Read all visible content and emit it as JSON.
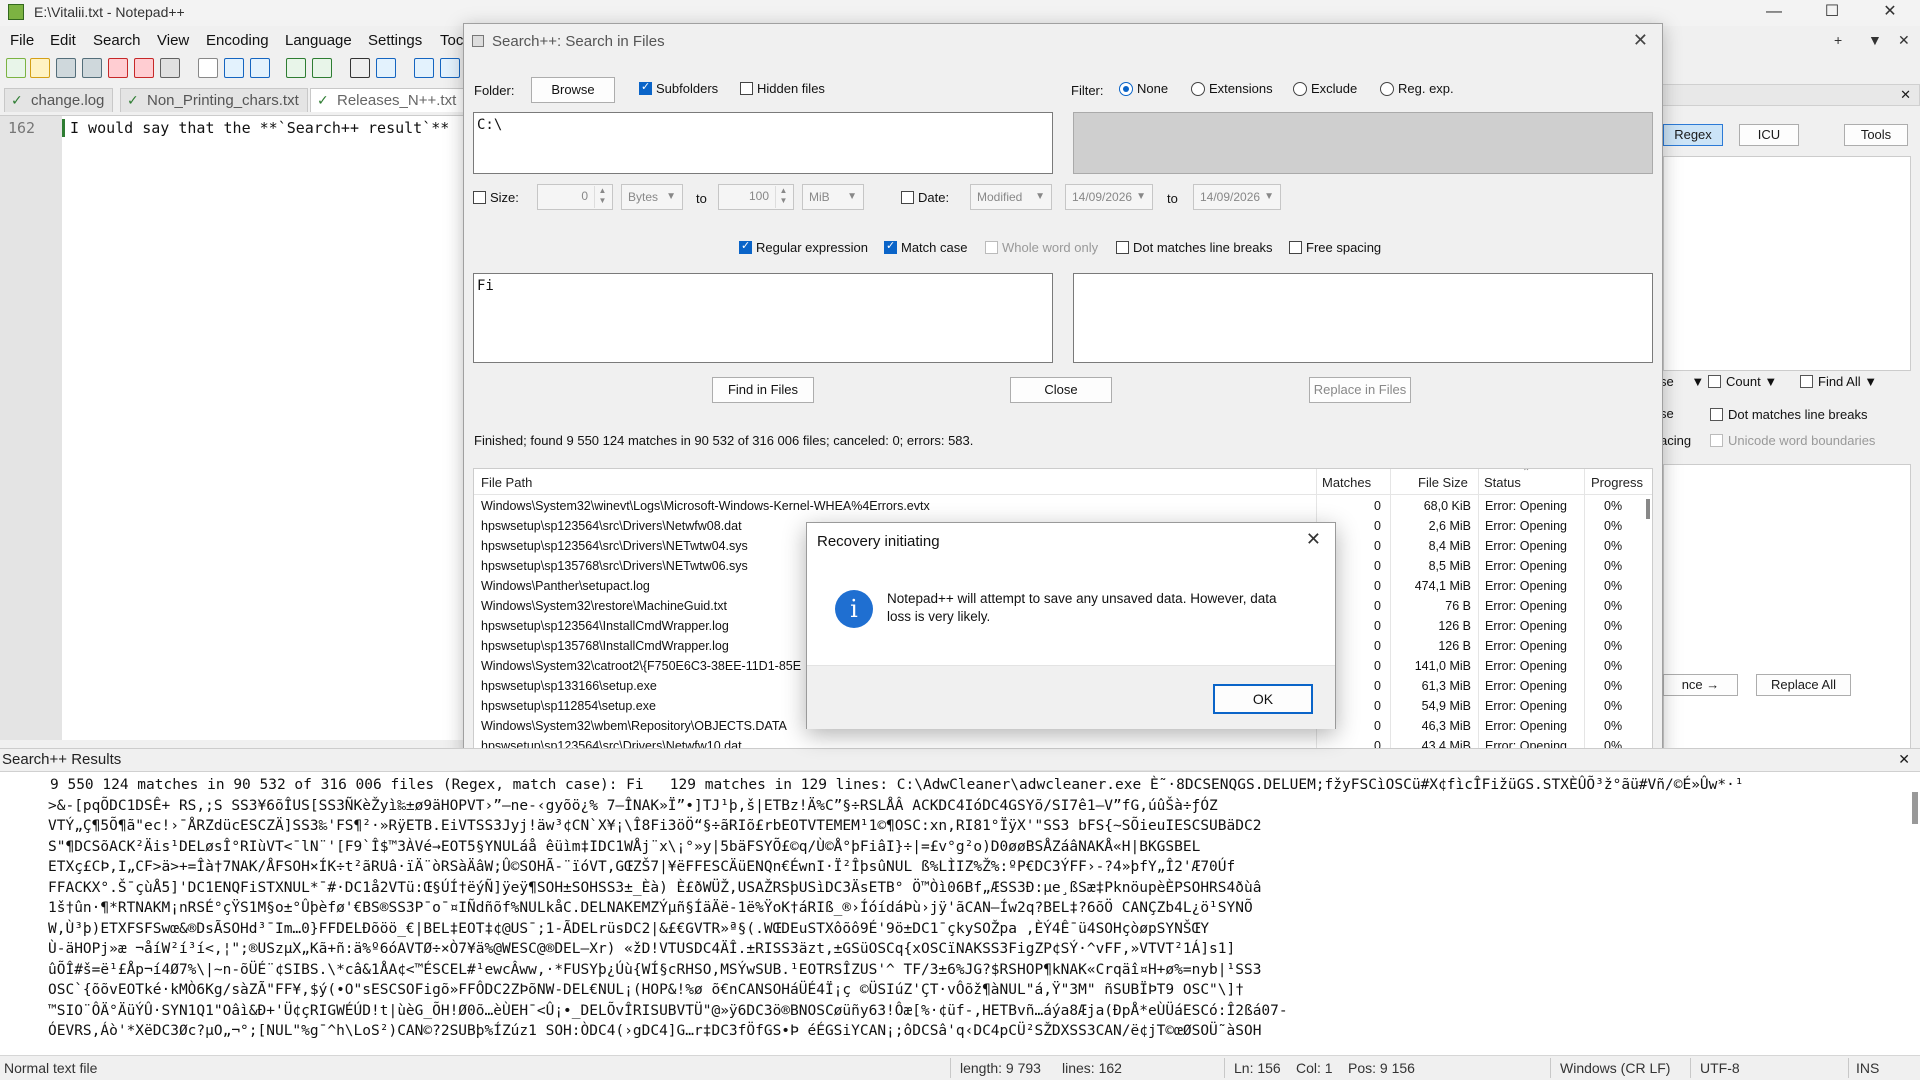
{
  "window": {
    "title": "E:\\Vitalii.txt - Notepad++"
  },
  "menu": [
    "File",
    "Edit",
    "Search",
    "View",
    "Encoding",
    "Language",
    "Settings",
    "Toc"
  ],
  "tabs": [
    "change.log",
    "Non_Printing_chars.txt",
    "Releases_N++.txt"
  ],
  "editor": {
    "line_number": "162",
    "line_text": "I would say that the **`Search++ result`**"
  },
  "right_panel": {
    "regex": "Regex",
    "icu": "ICU",
    "tools": "Tools",
    "count": "Count",
    "find_all": "Find All",
    "opt1": "Dot matches line breaks",
    "opt2": "Unicode word boundaries",
    "replace_all": "Replace All",
    "nce": "nce →",
    "se": "se",
    "acing": "acing"
  },
  "search_dialog": {
    "title": "Search++: Search in Files",
    "folder_label": "Folder:",
    "browse": "Browse",
    "subfolders": "Subfolders",
    "hidden_files": "Hidden files",
    "filter_label": "Filter:",
    "filter_options": [
      "None",
      "Extensions",
      "Exclude",
      "Reg. exp."
    ],
    "folder_value": "C:\\",
    "size_label": "Size:",
    "size_from": "0",
    "size_unit_from": "Bytes",
    "to_label": "to",
    "size_to": "100",
    "size_unit_to": "MiB",
    "date_label": "Date:",
    "date_kind": "Modified",
    "date_from": "14/09/2026",
    "date_to": "14/09/2026",
    "regular_expression": "Regular expression",
    "match_case": "Match case",
    "whole_word": "Whole word only",
    "dot_matches": "Dot matches line breaks",
    "free_spacing": "Free spacing",
    "search_value": "Fi",
    "find_in_files": "Find in Files",
    "close": "Close",
    "replace_in_files": "Replace in Files",
    "status": "Finished; found 9 550 124 matches in 90 532 of 316 006 files; canceled: 0; errors: 583.",
    "columns": [
      "File Path",
      "Matches",
      "File Size",
      "Status",
      "Progress"
    ],
    "rows": [
      {
        "path": "Windows\\System32\\winevt\\Logs\\Microsoft-Windows-Kernel-WHEA%4Errors.evtx",
        "matches": "0",
        "size": "68,0 KiB",
        "status": "Error: Opening",
        "progress": "0%"
      },
      {
        "path": "hpswsetup\\sp123564\\src\\Drivers\\Netwfw08.dat",
        "matches": "0",
        "size": "2,6 MiB",
        "status": "Error: Opening",
        "progress": "0%"
      },
      {
        "path": "hpswsetup\\sp123564\\src\\Drivers\\NETwtw04.sys",
        "matches": "0",
        "size": "8,4 MiB",
        "status": "Error: Opening",
        "progress": "0%"
      },
      {
        "path": "hpswsetup\\sp135768\\src\\Drivers\\NETwtw06.sys",
        "matches": "0",
        "size": "8,5 MiB",
        "status": "Error: Opening",
        "progress": "0%"
      },
      {
        "path": "Windows\\Panther\\setupact.log",
        "matches": "0",
        "size": "474,1 MiB",
        "status": "Error: Opening",
        "progress": "0%"
      },
      {
        "path": "Windows\\System32\\restore\\MachineGuid.txt",
        "matches": "0",
        "size": "76 B",
        "status": "Error: Opening",
        "progress": "0%"
      },
      {
        "path": "hpswsetup\\sp123564\\InstallCmdWrapper.log",
        "matches": "0",
        "size": "126 B",
        "status": "Error: Opening",
        "progress": "0%"
      },
      {
        "path": "hpswsetup\\sp135768\\InstallCmdWrapper.log",
        "matches": "0",
        "size": "126 B",
        "status": "Error: Opening",
        "progress": "0%"
      },
      {
        "path": "Windows\\System32\\catroot2\\{F750E6C3-38EE-11D1-85E",
        "matches": "0",
        "size": "141,0 MiB",
        "status": "Error: Opening",
        "progress": "0%"
      },
      {
        "path": "hpswsetup\\sp133166\\setup.exe",
        "matches": "0",
        "size": "61,3 MiB",
        "status": "Error: Opening",
        "progress": "0%"
      },
      {
        "path": "hpswsetup\\sp112854\\setup.exe",
        "matches": "0",
        "size": "54,9 MiB",
        "status": "Error: Opening",
        "progress": "0%"
      },
      {
        "path": "Windows\\System32\\wbem\\Repository\\OBJECTS.DATA",
        "matches": "0",
        "size": "46,3 MiB",
        "status": "Error: Opening",
        "progress": "0%"
      },
      {
        "path": "hpswsetup\\sp123564\\src\\Drivers\\Netwfw10.dat",
        "matches": "0",
        "size": "43,4 MiB",
        "status": "Error: Opening",
        "progress": "0%"
      }
    ]
  },
  "recovery_dialog": {
    "title": "Recovery initiating",
    "message": "Notepad++ will attempt to save any unsaved data. However, data loss is very likely.",
    "ok": "OK"
  },
  "results_panel": {
    "title": "Search++ Results",
    "lines": [
      "9 550 124 matches in 90 532 of 316 006 files (Regex, match case): Fi   129 matches in 129 lines: C:\\AdwCleaner\\adwcleaner.exe È˜·8DCSENQGS.DELUEM;fžyFSCìOSCü#X¢fìcÎFižüGS.STXÈÛÕ³ž°ãü#Vñ/©É»Ûw*·¹",
      ">&-[pqÕDC1DSÊ+ RS,;S SS3¥6õÎUS[SS3ÑKèŽyì‰±ø9äHOPVT›”—ne-‹gyõö¿% 7—ÎNAK»Ï”•]TJ¹þ,š|ETBz!Ä%C”§÷RSLÅÂ ACKDC4IóDC4GSYõ/SI7ê1—V”fG,úûŠà÷ƒÓZ",
      "VTÝ„Ç¶5Õ¶ã\"ec!›¯ÅRZdücESCZÄ]SS3‰'FS¶²·»RÿETB.EiVTSS3Jyj!äw³¢CN`X¥¡\\Î8Fi3öÖ“§÷ãRIõ£rbEOTVTEMEM¹1©¶OSC:xn,RI81°ÏÿX'\"SS3 bFS{~SÕieuIESCSUBäDC2",
      "S\"¶DCSõACK²Äis¹DELøsÎ°RIùVT<¯lN¨'[F9`Î$™3ÀVé→EOT5§YNULáå êüìm‡IDC1WÅj¨x\\¡°»y|5bäFSYÕ£©q/Ù©Å°þFiâI}÷|=£v°g²o)D0øøBSÅZáâNAKÅ«H|BKGSBEL",
      "ETXç£CÞ,I„CF>ä>+=Îà†7NAK/ÅFSOH×ÍK÷t²ãRUâ·ïÄ¨òRSàÄâW;Û©SOHÃ-¨ïóVT,GŒZŠ7|¥ëFFESCÄüENQn€ÉwnI·Ï²ÎþsûNUL ß%LÌIZ%Ž%:ºP€DC3ÝFF›-?4»þfY„Î2'Æ70Úf",
      "FFACKX°.Š¯çùÅ5]'DC1ENQFiSTXNUL*¯#·DC1å2VTü:Œ§ÚÍ†ëýÑ]ÿeÿ¶SOH±SOHSS3±_Èà) È£ðWÜŽ,USAŽRSþUSìDC3ÄsETB° Ö™Òì06Bf„ÆSS3Ð:µe¸ßSæ‡PknöupèÈPSOHRS4ðùâ",
      "1š†ûn·¶*RTNAKM¡nRSÉ°çŸS1M§o±°Ûþèfø'€BS®SS3P¯o¯¤IÑdñõf%NULkåC.DELNAKEMZÝµñ§ÍäÄë-1ë%ŸoK†áRIß_®›ÍóídáÞù›jÿ'ãCAN—Íw2q?BEL‡?6õÖ CANÇZb4L¿ö¹SYNÕ",
      "W,Ù³þ)ETXFSFSwœ&®DsÃSOHd³¯Im…0}FFDELÐõöö_€|BEL‡EOT‡¢@US¯;1-ÃDELrüsDC2|&£€GVTR»ª§(.WŒDEuSTXôõô9É'9ö±DC1¯çkySOŽpa ,ÈÝ4Ê¯ü4SOHçòøpSYNŠŒY",
      "Ù-äHOPj»æ ¬åíW²í³í<,¦\";®USzµX„Kã+ñ:ä%º6óAVTØ÷×Ò7¥ä%@WESC@®DEL—Xr) «žD!VTUSDC4ÄÎ.±RISS3äzt,±GSüOSCq{xOSCïNAKSS3FigZP¢SÝ·^vFF,»VTVT²1Á]s1]",
      "ûÕÎ#š=ë¹£Åp¬í4Ø7%\\|~n-õÜÉ¨¢SIBS.\\*câ&1ÅA¢<™ÉSCEL#¹ewcÂww,·*FUSYþ¿Úù{WÍ§cRHSO,MSÝwSUB.¹EOTRSÎZUS'^ TF/3±6%JG?$RSHOP¶kNAK«Crqäî¤H+ø%=nyb|¹SS3",
      "OSC`{õõvEOTké·kMÒ6Kg/sàZÃ\"FF¥,$ý(•O\"sESCSOFigõ»FFÔDC2ZÞõNW-DEL€NUL¡(HOP&!%ø õ€nCANSOHáÜÉ4Ï¡ç ©ÜSIúZ'ÇT·vÔõž¶àNUL\"á,Ÿ\"3M\" ñSUBÏÞT9 OSC\"\\]†",
      "™SIO¨ÔÄ°ÄüÝÛ·SYN1Q1\"Oâì&Ð+'Ü¢çRIGWÉÚD!t|ùèG_ÕH!Ø0õ…èÙEH¯<Û¡•_DELÕvÎRISUBVTÜ\"@»ÿ6DC3ö®BNOSCøüñy63!Ôæ[%·¢üf-,HETBvñ…áýa8Æja(ÐpÅ*eÙÜáESCó:Î2ßá07-",
      "ÓEVRS,Áò'*XëDC3Øc?µO„¬°;[NUL\"%g¯^h\\LoS²)CAN©?2SUBþ%ÍZúz1 SOH:ÒDC4(›gDC4]G…r‡DC3fÖfGS•Þ éÉGSiYCAN¡;ôDCSâ'q‹DC4pCÜ²SŽDXSS3CAN/ë¢jT©œØSOÜ˜àSOH"
    ]
  },
  "statusbar": {
    "type": "Normal text file",
    "length": "length: 9 793",
    "lines": "lines: 162",
    "ln": "Ln: 156",
    "col": "Col: 1",
    "pos": "Pos: 9 156",
    "eol": "Windows (CR LF)",
    "encoding": "UTF-8",
    "ins": "INS"
  }
}
